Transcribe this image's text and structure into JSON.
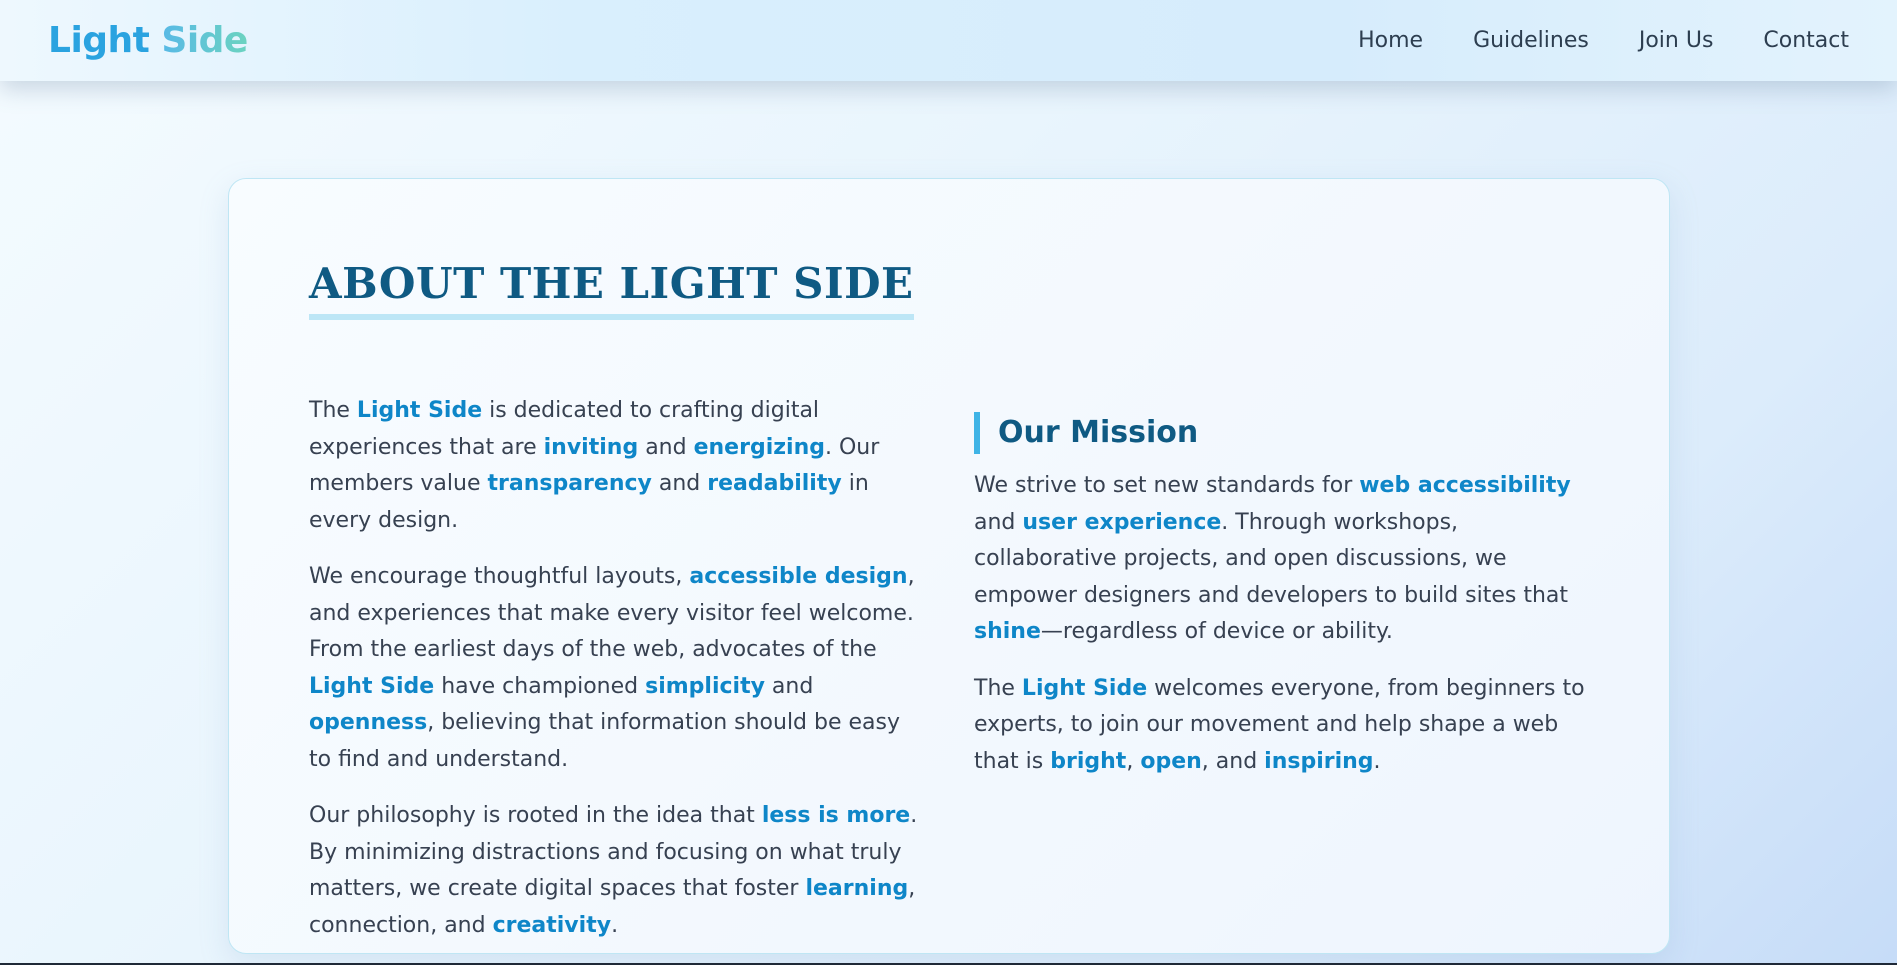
{
  "brand": {
    "part1": "Light",
    "part2": "Side"
  },
  "nav": {
    "items": [
      "Home",
      "Guidelines",
      "Join Us",
      "Contact"
    ]
  },
  "about": {
    "title": "ABOUT THE LIGHT SIDE",
    "left_paragraphs": [
      [
        {
          "t": "The ",
          "h": false
        },
        {
          "t": "Light Side",
          "h": true
        },
        {
          "t": " is dedicated to crafting digital experiences that are ",
          "h": false
        },
        {
          "t": "inviting",
          "h": true
        },
        {
          "t": " and ",
          "h": false
        },
        {
          "t": "energizing",
          "h": true
        },
        {
          "t": ". Our members value ",
          "h": false
        },
        {
          "t": "transparency",
          "h": true
        },
        {
          "t": " and ",
          "h": false
        },
        {
          "t": "readability",
          "h": true
        },
        {
          "t": " in every design.",
          "h": false
        }
      ],
      [
        {
          "t": "We encourage thoughtful layouts, ",
          "h": false
        },
        {
          "t": "accessible design",
          "h": true
        },
        {
          "t": ", and experiences that make every visitor feel welcome. From the earliest days of the web, advocates of the ",
          "h": false
        },
        {
          "t": "Light Side",
          "h": true
        },
        {
          "t": " have championed ",
          "h": false
        },
        {
          "t": "simplicity",
          "h": true
        },
        {
          "t": " and ",
          "h": false
        },
        {
          "t": "openness",
          "h": true
        },
        {
          "t": ", believing that information should be easy to find and understand.",
          "h": false
        }
      ],
      [
        {
          "t": "Our philosophy is rooted in the idea that ",
          "h": false
        },
        {
          "t": "less is more",
          "h": true
        },
        {
          "t": ". By minimizing distractions and focusing on what truly matters, we create digital spaces that foster ",
          "h": false
        },
        {
          "t": "learning",
          "h": true
        },
        {
          "t": ", connection, and ",
          "h": false
        },
        {
          "t": "creativity",
          "h": true
        },
        {
          "t": ".",
          "h": false
        }
      ]
    ],
    "mission_title": "Our Mission",
    "right_paragraphs": [
      [
        {
          "t": "We strive to set new standards for ",
          "h": false
        },
        {
          "t": "web accessibility",
          "h": true
        },
        {
          "t": " and ",
          "h": false
        },
        {
          "t": "user experience",
          "h": true
        },
        {
          "t": ". Through workshops, collaborative projects, and open discussions, we empower designers and developers to build sites that ",
          "h": false
        },
        {
          "t": "shine",
          "h": true
        },
        {
          "t": "—regardless of device or ability.",
          "h": false
        }
      ],
      [
        {
          "t": "The ",
          "h": false
        },
        {
          "t": "Light Side",
          "h": true
        },
        {
          "t": " welcomes everyone, from beginners to experts, to join our movement and help shape a web that is ",
          "h": false
        },
        {
          "t": "bright",
          "h": true
        },
        {
          "t": ", ",
          "h": false
        },
        {
          "t": "open",
          "h": true
        },
        {
          "t": ", and ",
          "h": false
        },
        {
          "t": "inspiring",
          "h": true
        },
        {
          "t": ".",
          "h": false
        }
      ]
    ]
  }
}
